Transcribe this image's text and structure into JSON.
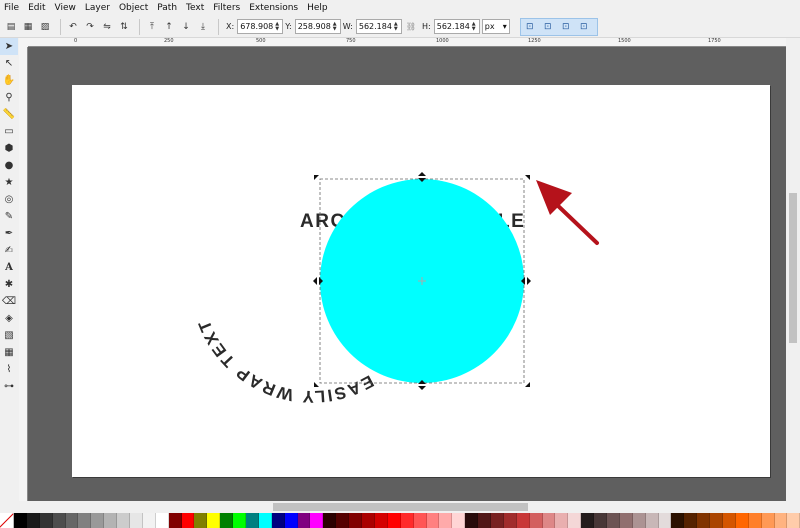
{
  "menu": [
    "File",
    "Edit",
    "View",
    "Layer",
    "Object",
    "Path",
    "Text",
    "Filters",
    "Extensions",
    "Help"
  ],
  "toolbar": {
    "x_label": "X:",
    "x_value": "678.908",
    "y_label": "Y:",
    "y_value": "258.908",
    "w_label": "W:",
    "w_value": "562.184",
    "h_label": "H:",
    "h_value": "562.184",
    "unit": "px"
  },
  "ruler_labels": [
    "0",
    "250",
    "500",
    "750",
    "1000",
    "1250",
    "1500",
    "1750"
  ],
  "canvas": {
    "text_top": "ARC",
    "text_top_right": "LE",
    "text_arc": "EASILY WRAP TEXT",
    "circle_color": "#00ffff"
  },
  "tools": [
    "selector-tool-icon",
    "node-tool-icon",
    "tweak-tool-icon",
    "zoom-tool-icon",
    "measure-tool-icon",
    "rect-tool-icon",
    "3dbox-tool-icon",
    "ellipse-tool-icon",
    "star-tool-icon",
    "spiral-tool-icon",
    "pencil-tool-icon",
    "pen-tool-icon",
    "calligraphy-tool-icon",
    "text-tool-icon",
    "spray-tool-icon",
    "eraser-tool-icon",
    "bucket-tool-icon",
    "gradient-tool-icon",
    "mesh-tool-icon",
    "dropper-tool-icon",
    "connector-tool-icon"
  ],
  "palette_colors": [
    "#000000",
    "#1a1a1a",
    "#333333",
    "#4d4d4d",
    "#666666",
    "#808080",
    "#999999",
    "#b3b3b3",
    "#cccccc",
    "#e6e6e6",
    "#f2f2f2",
    "#ffffff",
    "#800000",
    "#ff0000",
    "#808000",
    "#ffff00",
    "#008000",
    "#00ff00",
    "#008080",
    "#00ffff",
    "#000080",
    "#0000ff",
    "#800080",
    "#ff00ff",
    "#2b0000",
    "#550000",
    "#800000",
    "#aa0000",
    "#d40000",
    "#ff0000",
    "#ff2a2a",
    "#ff5555",
    "#ff8080",
    "#ffaaaa",
    "#ffd5d5",
    "#280b0b",
    "#501616",
    "#782121",
    "#a02c2c",
    "#c83737",
    "#d35f5f",
    "#de8787",
    "#e9afaf",
    "#f4d7d7",
    "#241c1c",
    "#483737",
    "#6c5353",
    "#916f6f",
    "#ac9393",
    "#c8b7b7",
    "#e3dbdb",
    "#2b1100",
    "#552200",
    "#803300",
    "#aa4400",
    "#d45500",
    "#ff6600",
    "#ff7f2a",
    "#ff9955",
    "#ffb380",
    "#ffccaa"
  ]
}
